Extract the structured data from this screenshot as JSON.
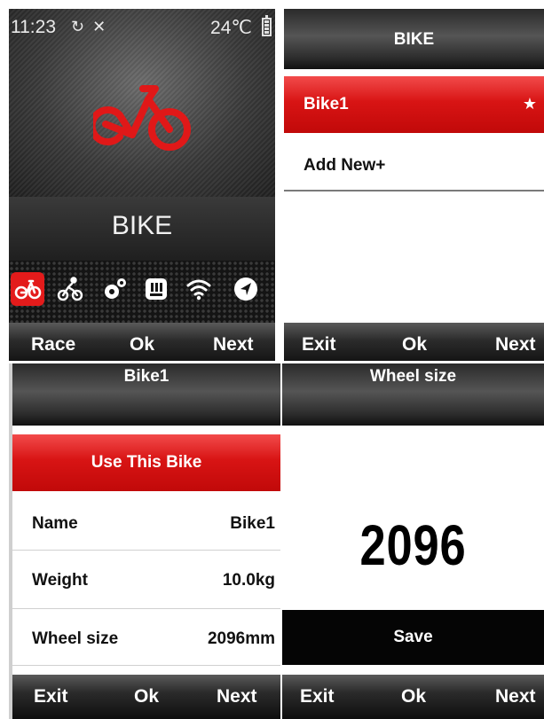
{
  "home": {
    "status": {
      "time": "11:23",
      "icons": "↻ ✕",
      "temperature": "24℃"
    },
    "title": "BIKE",
    "dock": [
      "bike-mode-icon",
      "cycling-icon",
      "settings-icon",
      "data-icon",
      "wifi-icon",
      "navigation-icon"
    ],
    "softkeys": {
      "left": "Race",
      "center": "Ok",
      "right": "Next"
    }
  },
  "bike_list": {
    "header": "BIKE",
    "items": [
      {
        "label": "Bike1",
        "marker": "★",
        "selected": true
      },
      {
        "label": "Add New+",
        "marker": "",
        "selected": false
      }
    ],
    "softkeys": {
      "left": "Exit",
      "center": "Ok",
      "right": "Next"
    }
  },
  "bike_detail": {
    "header": "Bike1",
    "action": "Use This Bike",
    "rows": [
      {
        "label": "Name",
        "value": "Bike1"
      },
      {
        "label": "Weight",
        "value": "10.0kg"
      },
      {
        "label": "Wheel size",
        "value": "2096mm"
      }
    ],
    "softkeys": {
      "left": "Exit",
      "center": "Ok",
      "right": "Next"
    }
  },
  "wheel_size": {
    "header": "Wheel size",
    "value": "2096",
    "save_label": "Save",
    "softkeys": {
      "left": "Exit",
      "center": "Ok",
      "right": "Next"
    }
  },
  "colors": {
    "accent": "#e31b1b",
    "bar_dark": "#111111",
    "text_light": "#ffffff"
  }
}
